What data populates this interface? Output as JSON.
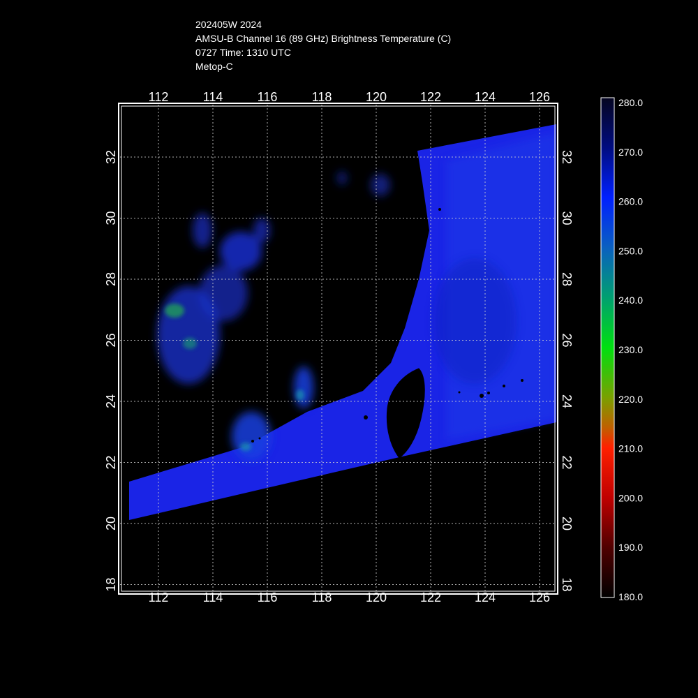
{
  "header": {
    "storm_line": "202405W 2024",
    "product_line": "AMSU-B Channel 16 (89 GHz) Brightness Temperature (C)",
    "time_line": "0727 Time: 1310 UTC",
    "satellite_line": "Metop-C"
  },
  "map": {
    "lon_ticks": [
      112,
      114,
      116,
      118,
      120,
      122,
      124,
      126
    ],
    "lat_ticks": [
      18,
      20,
      22,
      24,
      26,
      28,
      30,
      32
    ],
    "lon_labels": [
      "112",
      "114",
      "116",
      "118",
      "120",
      "122",
      "124",
      "126"
    ],
    "lat_labels": [
      "18",
      "20",
      "22",
      "24",
      "26",
      "28",
      "30",
      "32"
    ],
    "lon_range": [
      110.9,
      126.8
    ],
    "lat_range": [
      17.7,
      33.8
    ],
    "grid": true,
    "background_color": "#000000",
    "swath_color": "#1a22e0",
    "land_color": "#000000"
  },
  "colorbar": {
    "labels": [
      "280.0",
      "270.0",
      "260.0",
      "250.0",
      "240.0",
      "230.0",
      "220.0",
      "210.0",
      "200.0",
      "190.0",
      "180.0"
    ],
    "range": [
      180,
      280
    ],
    "colors": [
      "#0a0a2a",
      "#001070",
      "#0022ff",
      "#0a55c0",
      "#00a060",
      "#00e000",
      "#a08000",
      "#e02000",
      "#b00000",
      "#400000",
      "#000000"
    ]
  }
}
